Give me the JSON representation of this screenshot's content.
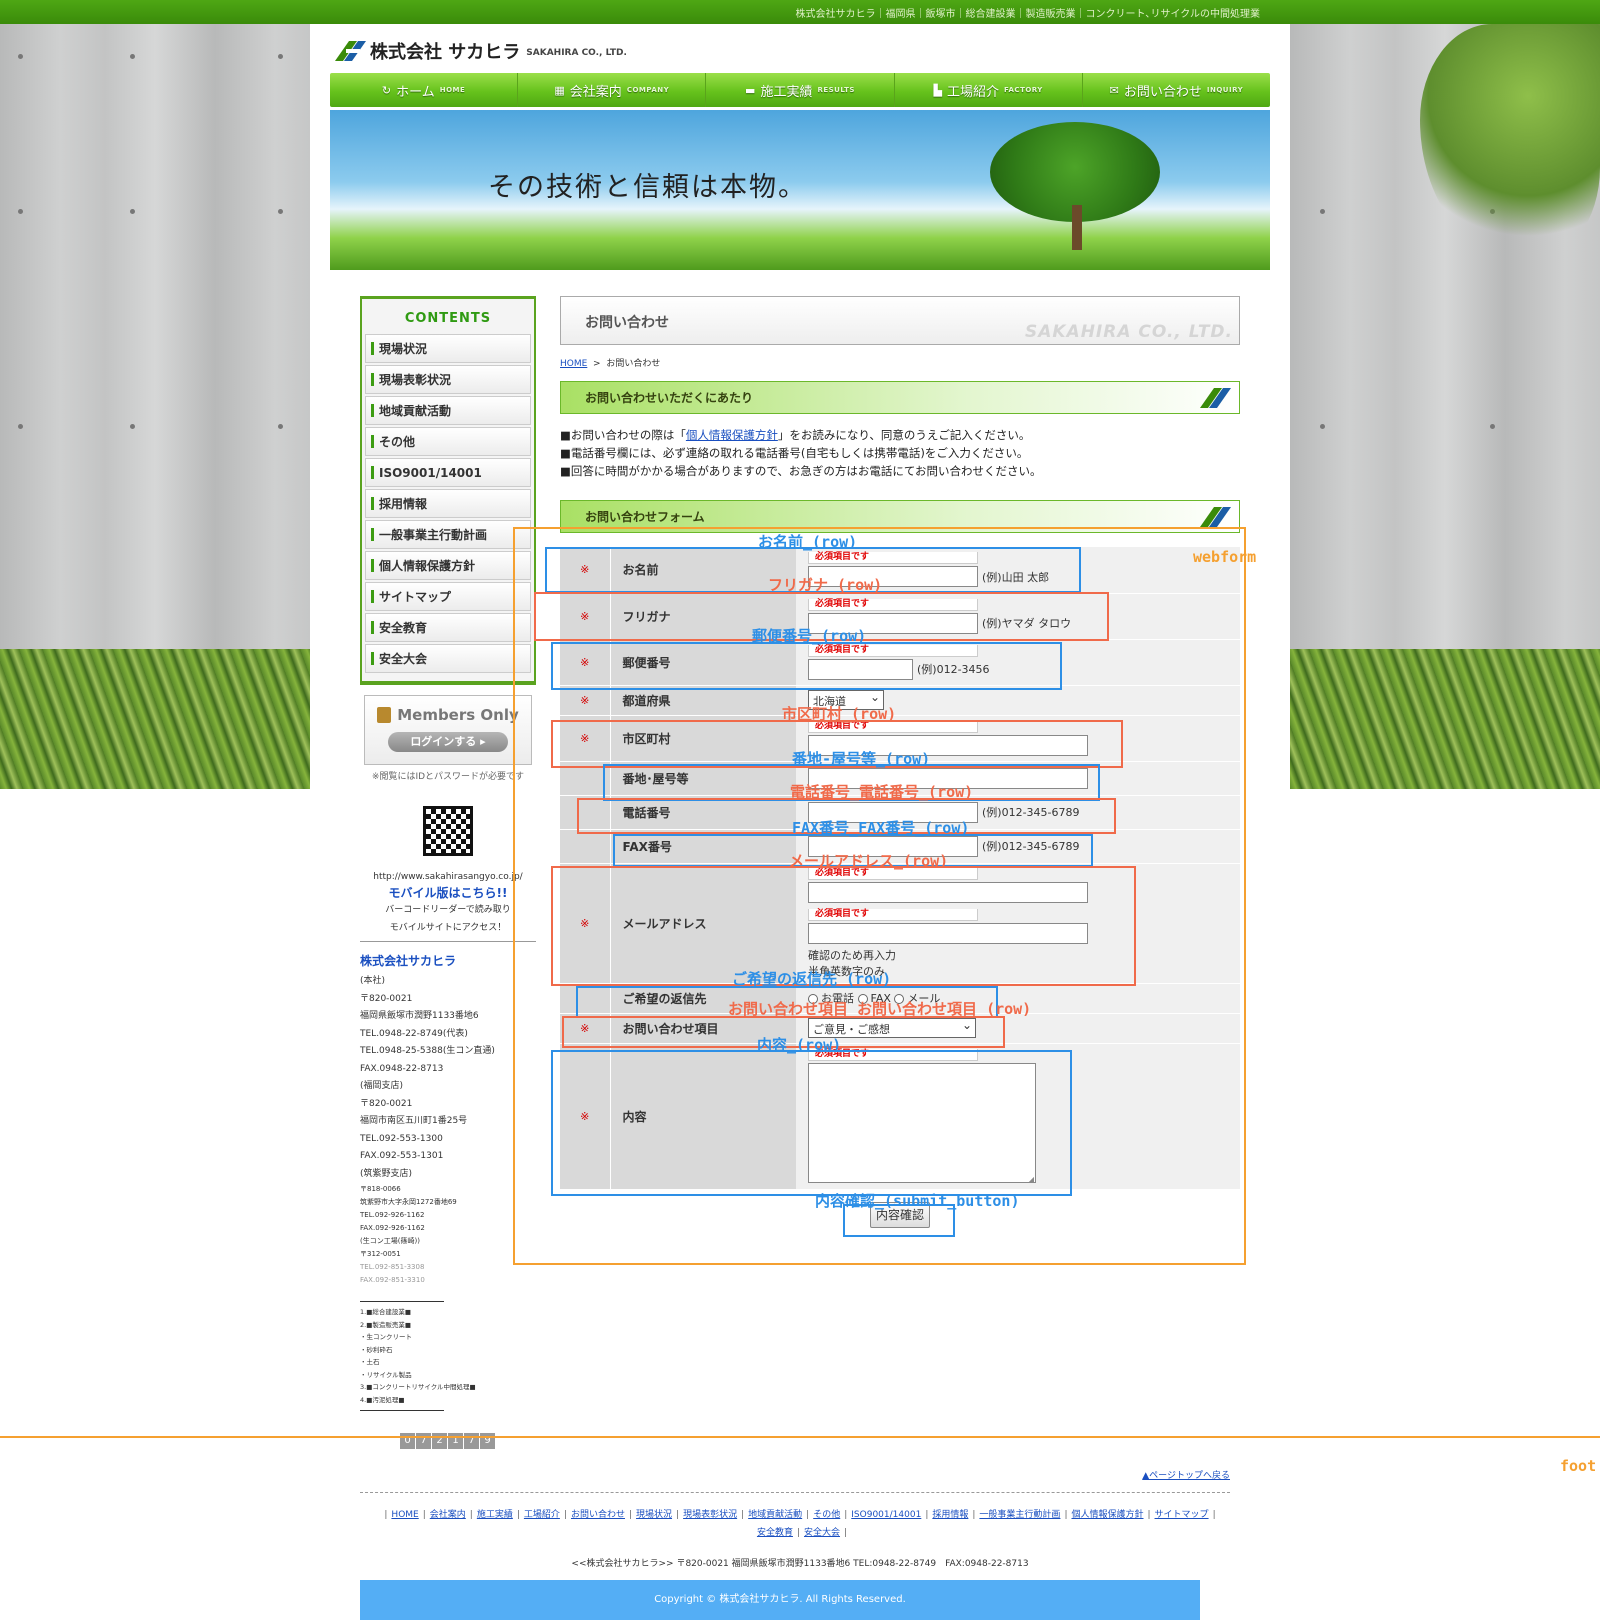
{
  "topbar": {
    "text": "株式会社サカヒラ｜福岡県｜飯塚市｜総合建設業｜製造販売業｜コンクリート､リサイクルの中間処理業"
  },
  "logo": {
    "jp": "株式会社 サカヒラ",
    "en": "SAKAHIRA CO., LTD."
  },
  "nav": [
    {
      "label": "ホーム",
      "sub": "HOME",
      "icon": "home-icon"
    },
    {
      "label": "会社案内",
      "sub": "COMPANY",
      "icon": "building-icon"
    },
    {
      "label": "施工実績",
      "sub": "RESULTS",
      "icon": "truck-icon"
    },
    {
      "label": "工場紹介",
      "sub": "FACTORY",
      "icon": "factory-icon"
    },
    {
      "label": "お問い合わせ",
      "sub": "INQUIRY",
      "icon": "mail-icon"
    }
  ],
  "hero": {
    "catch": "その技術と信頼は本物。"
  },
  "sidebar": {
    "title": "CONTENTS",
    "items": [
      "現場状況",
      "現場表彰状況",
      "地域貢献活動",
      "その他",
      "ISO9001/14001",
      "採用情報",
      "一般事業主行動計画",
      "個人情報保護方針",
      "サイトマップ",
      "安全教育",
      "安全大会"
    ],
    "members_title": "Members Only",
    "login_label": "ログインする ▸",
    "members_note": "※閲覧にはIDとパスワードが必要です",
    "url": "http://www.sakahirasangyo.co.jp/",
    "mobile": "モバイル版はこちら!!",
    "mobile_note1": "バーコードリーダーで読み取り",
    "mobile_note2": "モバイルサイトにアクセス！",
    "company": "株式会社サカヒラ",
    "address": [
      "(本社)",
      "〒820-0021",
      "福岡県飯塚市潤野1133番地6",
      "TEL.0948-22-8749(代表)",
      "TEL.0948-25-5388(生コン直通)",
      "FAX.0948-22-8713",
      "(福岡支店)",
      "〒820-0021",
      "福岡市南区五川町1番25号",
      "TEL.092-553-1300",
      "FAX.092-553-1301",
      "(筑紫野支店)"
    ],
    "address_small": [
      "〒818-0066",
      "筑紫野市大字永岡1272番地69",
      "TEL.092-926-1162",
      "FAX.092-926-1162",
      "(生コン工場(篠崎))",
      "〒312-0051",
      "TEL.092-851-3308",
      "FAX.092-851-3310"
    ],
    "business": [
      "1.■総合建設業■",
      "2.■製造販売業■",
      "・生コンクリート",
      "・砂利砕石",
      "・土石",
      "・リサイクル製品",
      "3.■コンクリートリサイクル中間処理■",
      "4.■汚泥処理■"
    ],
    "counter": [
      "0",
      "7",
      "2",
      "1",
      "7",
      "9"
    ]
  },
  "main": {
    "page_title": "お問い合わせ",
    "page_title_en": "SAKAHIRA CO., LTD.",
    "breadcrumb_home": "HOME",
    "breadcrumb_sep": ">",
    "breadcrumb_current": "お問い合わせ",
    "sec1": "お問い合わせいただくにあたり",
    "intro1_pre": "■お問い合わせの際は「",
    "intro1_link": "個人情報保護方針",
    "intro1_post": "」をお読みになり、同意のうえご記入ください。",
    "intro2": "■電話番号欄には、必ず連絡の取れる電話番号(自宅もしくは携帯電話)をご入力ください。",
    "intro3": "■回答に時間がかかる場合がありますので、お急ぎの方はお電話にてお問い合わせください。",
    "sec2": "お問い合わせフォーム"
  },
  "form": {
    "req_mark": "※",
    "must": "必須項目です",
    "name_label": "お名前",
    "name_ex": "(例)山田 太郎",
    "kana_label": "フリガナ",
    "kana_ex": "(例)ヤマダ タロウ",
    "zip_label": "郵便番号",
    "zip_ex": "(例)012-3456",
    "pref_label": "都道府県",
    "pref_value": "北海道",
    "city_label": "市区町村",
    "addr_label": "番地･屋号等",
    "tel_label": "電話番号",
    "tel_ex": "(例)012-345-6789",
    "fax_label": "FAX番号",
    "fax_ex": "(例)012-345-6789",
    "mail_label": "メールアドレス",
    "mail_confirm": "確認のため再入力",
    "mail_note": "半角英数字のみ",
    "reply_label": "ご希望の返信先",
    "reply_opts": [
      "お電話",
      "FAX",
      "メール"
    ],
    "topic_label": "お問い合わせ項目",
    "topic_value": "ご意見・ご感想",
    "content_label": "内容",
    "submit": "内容確認"
  },
  "annotations": {
    "webform": "webform",
    "name": "お名前_(row)",
    "kana": "フリガナ_(row)",
    "zip": "郵便番号_(row)",
    "city": "市区町村_(row)",
    "addr": "番地-屋号等_(row)",
    "tel": "電話番号_電話番号_(row)",
    "fax": "FAX番号_FAX番号_(row)",
    "mail": "メールアドレス_(row)",
    "reply": "ご希望の返信先_(row)",
    "topic": "お問い合わせ項目_お問い合わせ項目_(row)",
    "content": "内容_(row)",
    "submit": "内容確認_(submit_button)",
    "footer": "foot"
  },
  "footer": {
    "totop": "▲ページトップへ戻る",
    "links": [
      "HOME",
      "会社案内",
      "施工実績",
      "工場紹介",
      "お問い合わせ",
      "現場状況",
      "現場表彰状況",
      "地域貢献活動",
      "その他",
      "ISO9001/14001",
      "採用情報",
      "一般事業主行動計画",
      "個人情報保護方針",
      "サイトマップ",
      "安全教育",
      "安全大会"
    ],
    "address": "<<株式会社サカヒラ>> 〒820-0021 福岡県飯塚市潤野1133番地6 TEL:0948-22-8749　FAX:0948-22-8713",
    "copyright": "Copyright © 株式会社サカヒラ. All Rights Reserved."
  }
}
